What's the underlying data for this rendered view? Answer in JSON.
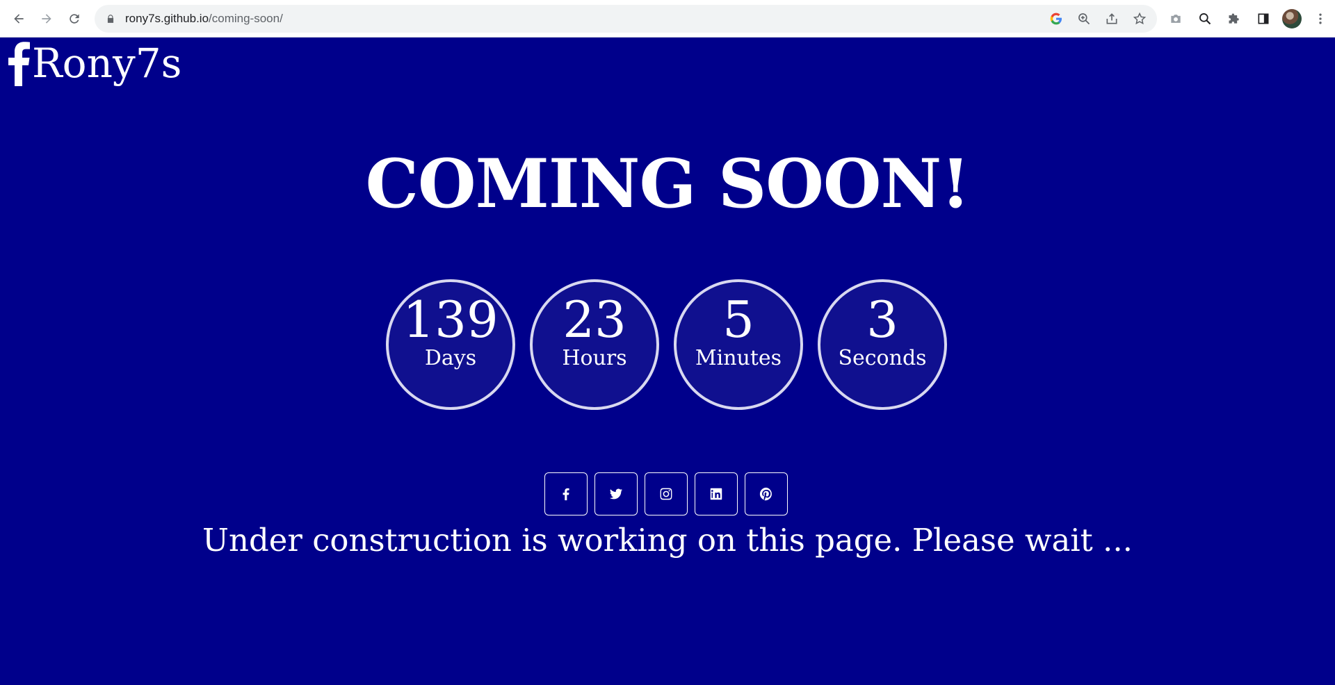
{
  "browser": {
    "url_host": "rony7s.github.io",
    "url_path": "/coming-soon/",
    "icons": [
      "back-icon",
      "forward-icon",
      "reload-icon",
      "lock-icon",
      "google-icon",
      "zoom-icon",
      "share-icon",
      "star-icon",
      "camera-icon",
      "search-icon",
      "extensions-icon",
      "sidepanel-icon",
      "avatar",
      "menu-icon"
    ]
  },
  "brand": {
    "icon": "facebook-icon",
    "name": "Rony7s"
  },
  "title": "COMING SOON!",
  "countdown": [
    {
      "value": "139",
      "label": "Days"
    },
    {
      "value": "23",
      "label": "Hours"
    },
    {
      "value": "5",
      "label": "Minutes"
    },
    {
      "value": "3",
      "label": "Seconds"
    }
  ],
  "socials": [
    "facebook-icon",
    "twitter-icon",
    "instagram-icon",
    "linkedin-icon",
    "pinterest-icon"
  ],
  "tagline": "Under construction is working on this page. Please wait ...",
  "colors": {
    "background": "#00008b",
    "text": "#ffffff",
    "circle_border": "#d8d8f0"
  }
}
